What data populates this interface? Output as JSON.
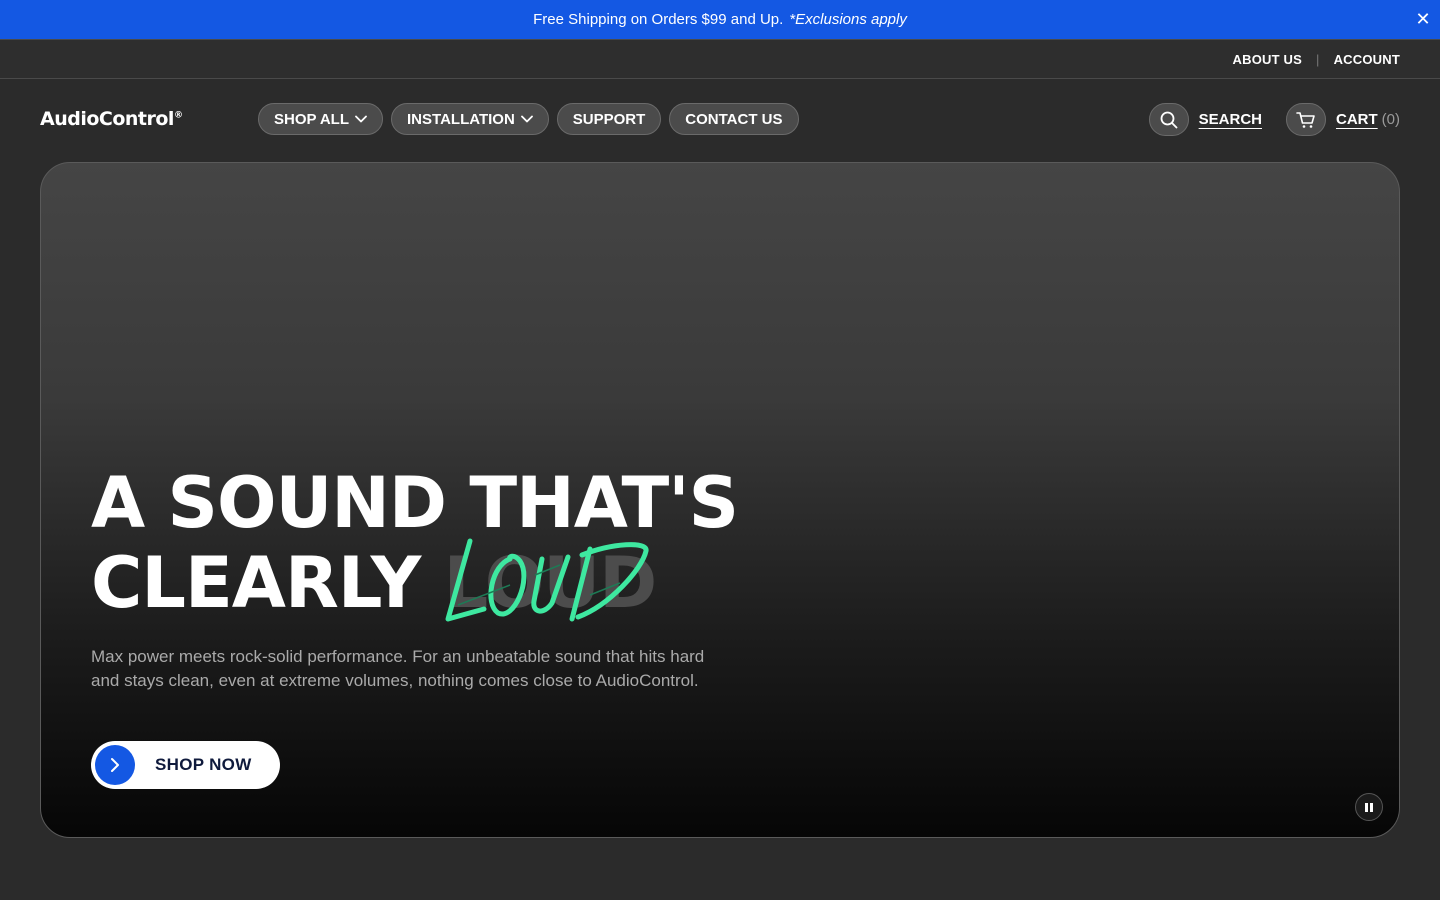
{
  "announcement": {
    "text": "Free Shipping on Orders $99 and Up.",
    "note": "*Exclusions apply",
    "close_label": "✕"
  },
  "utility_nav": {
    "about": "ABOUT US",
    "separator": "|",
    "account": "ACCOUNT"
  },
  "header": {
    "logo": "AudioControl",
    "logo_mark": "®",
    "nav": {
      "shop_all": "SHOP ALL",
      "installation": "INSTALLATION",
      "support": "SUPPORT",
      "contact": "CONTACT US"
    },
    "search_label": "SEARCH",
    "cart_label": "CART",
    "cart_count": "(0)"
  },
  "hero": {
    "headline_line1": "A SOUND THAT'S",
    "headline_line2": "CLEARLY",
    "headline_word": "LOUD",
    "subtext": "Max power meets rock-solid performance. For an unbeatable sound that hits hard and stays clean, even at extreme volumes, nothing comes close to AudioControl.",
    "cta_label": "SHOP NOW"
  },
  "colors": {
    "brand_blue": "#1458e3",
    "accent_green": "#3ee8a0",
    "background": "#2b2b2b"
  },
  "icons": {
    "close": "close-icon",
    "chevron": "chevron-down-icon",
    "search": "search-icon",
    "cart": "cart-icon",
    "cta": "chevron-right-icon",
    "pause": "pause-icon"
  }
}
